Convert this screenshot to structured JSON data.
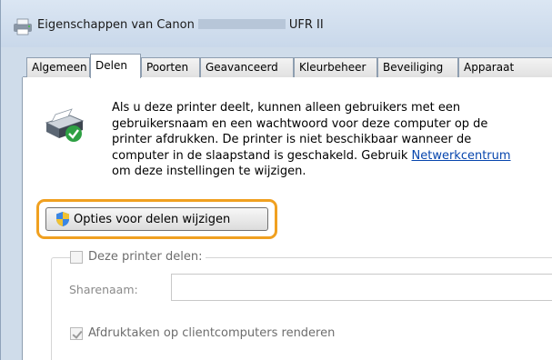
{
  "window": {
    "title_prefix": "Eigenschappen van Canon",
    "title_suffix": "UFR II"
  },
  "tabs": [
    {
      "label": "Algemeen"
    },
    {
      "label": "Delen"
    },
    {
      "label": "Poorten"
    },
    {
      "label": "Geavanceerd"
    },
    {
      "label": "Kleurbeheer"
    },
    {
      "label": "Beveiliging"
    },
    {
      "label": "Apparaat"
    }
  ],
  "active_tab": "Delen",
  "sharing": {
    "info_lines": [
      "Als u deze printer deelt, kunnen alleen gebruikers met een",
      "gebruikersnaam en een wachtwoord voor deze computer op de",
      "printer afdrukken. De printer is niet beschikbaar wanneer de"
    ],
    "info_line4_prefix": "computer in de slaapstand is geschakeld. Gebruik ",
    "info_link": "Netwerkcentrum",
    "info_line5": "om deze instellingen te wijzigen.",
    "change_options_button": "Opties voor delen wijzigen",
    "share_printer_label": "Deze printer delen:",
    "share_printer_checked": false,
    "share_name_label": "Sharenaam:",
    "share_name_value": "",
    "render_jobs_label": "Afdruktaken op clientcomputers renderen",
    "render_jobs_checked": true
  },
  "colors": {
    "highlight": "#f0a020",
    "link": "#0645ad",
    "title_bar": "#cfdcea"
  },
  "icons": {
    "title": "printer-icon",
    "printer_share": "shared-printer-icon",
    "uac": "uac-shield-icon"
  }
}
